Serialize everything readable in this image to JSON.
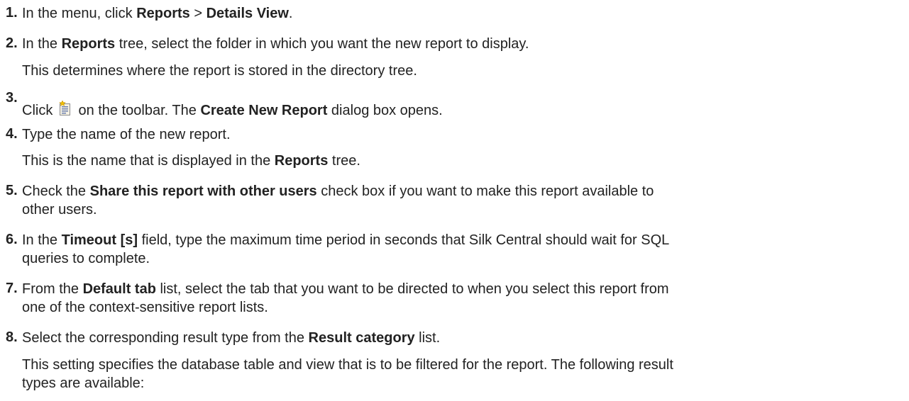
{
  "steps": [
    {
      "number": "1.",
      "text": {
        "a": "In the menu, click ",
        "b": "Reports",
        "c": " > ",
        "d": "Details View",
        "e": "."
      }
    },
    {
      "number": "2.",
      "text": {
        "a": "In the ",
        "b": "Reports",
        "c": " tree, select the folder in which you want the new report to display."
      },
      "note": "This determines where the report is stored in the directory tree."
    },
    {
      "number": "3.",
      "text": {
        "a": "Click ",
        "b": " on the toolbar. The ",
        "c": "Create New Report",
        "d": " dialog box opens."
      },
      "icon": "new-report-icon"
    },
    {
      "number": "4.",
      "text": {
        "a": "Type the name of the new report."
      },
      "note": {
        "a": "This is the name that is displayed in the ",
        "b": "Reports",
        "c": " tree."
      }
    },
    {
      "number": "5.",
      "text": {
        "a": "Check the ",
        "b": "Share this report with other users",
        "c": " check box if you want to make this report available to",
        "d": "other users."
      }
    },
    {
      "number": "6.",
      "text": {
        "a": "In the ",
        "b": "Timeout [s]",
        "c": " field, type the maximum time period in seconds that Silk Central should wait for SQL",
        "d": "queries to complete."
      }
    },
    {
      "number": "7.",
      "text": {
        "a": "From the ",
        "b": "Default tab",
        "c": " list, select the tab that you want to be directed to when you select this report from",
        "d": "one of the context-sensitive report lists."
      }
    },
    {
      "number": "8.",
      "text": {
        "a": "Select the corresponding result type from the ",
        "b": "Result category",
        "c": " list."
      },
      "note": {
        "a": "This setting specifies the database table and view that is to be filtered for the report. The following result",
        "b": "types are available:"
      }
    }
  ]
}
